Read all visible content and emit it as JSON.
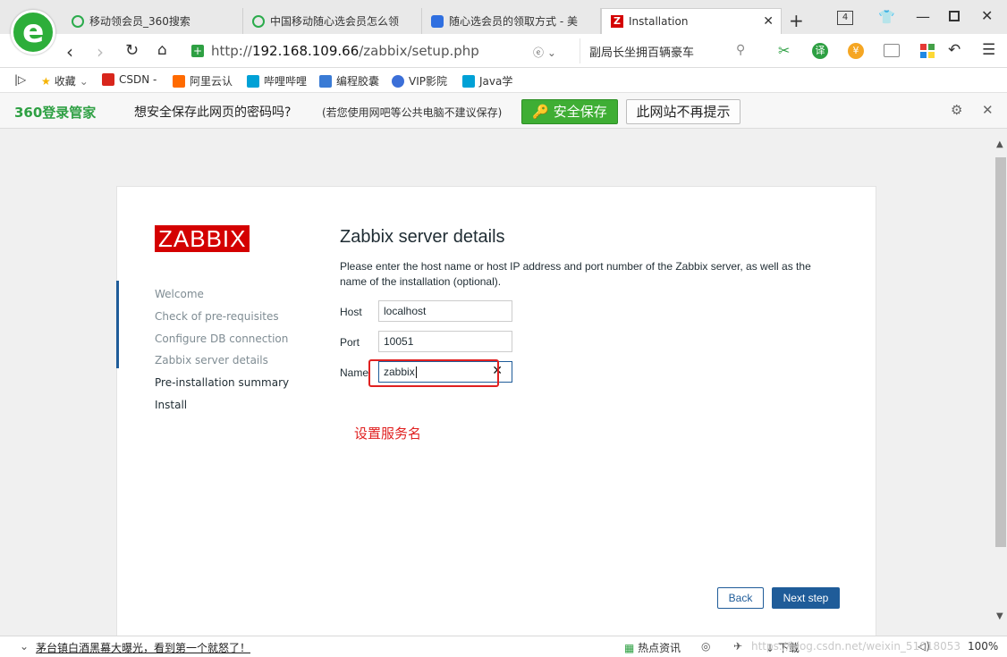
{
  "tabs": [
    {
      "title": "移动领会员_360搜索"
    },
    {
      "title": "中国移动随心选会员怎么领"
    },
    {
      "title": "随心选会员的领取方式 - 美"
    },
    {
      "title": "Installation"
    }
  ],
  "window": {
    "tab_count": "4"
  },
  "address": {
    "url_prefix": "http://",
    "url_host": "192.168.109.66",
    "url_path": "/zabbix/setup.php",
    "search_hint": "副局长坐拥百辆豪车"
  },
  "bookmarks": [
    "收藏",
    "CSDN -",
    "阿里云认",
    "哔哩哔哩",
    "编程胶囊",
    "VIP影院",
    "Java学"
  ],
  "password_bar": {
    "brand": "360登录管家",
    "question": "想安全保存此网页的密码吗?",
    "note": "(若您使用网吧等公共电脑不建议保存)",
    "save_label": "安全保存",
    "never_label": "此网站不再提示"
  },
  "page": {
    "logo": "ZABBIX",
    "steps": [
      {
        "label": "Welcome"
      },
      {
        "label": "Check of pre-requisites"
      },
      {
        "label": "Configure DB connection"
      },
      {
        "label": "Zabbix server details"
      },
      {
        "label": "Pre-installation summary"
      },
      {
        "label": "Install"
      }
    ],
    "title": "Zabbix server details",
    "description": "Please enter the host name or host IP address and port number of the Zabbix server, as well as the name of the installation (optional).",
    "fields": {
      "host_label": "Host",
      "host_value": "localhost",
      "port_label": "Port",
      "port_value": "10051",
      "name_label": "Name",
      "name_value": "zabbix"
    },
    "annotation": "设置服务名",
    "back_label": "Back",
    "next_label": "Next step"
  },
  "statusbar": {
    "news": "茅台镇白酒黑幕大曝光，看到第一个就怒了！",
    "hot": "热点资讯",
    "download": "下载",
    "watermark": "https://blog.csdn.net/weixin_51018053",
    "zoom": "100%"
  },
  "colors": {
    "zabbix_red": "#d40000",
    "zabbix_blue": "#1f5c99",
    "annotation_red": "#e02020",
    "save_green": "#3fae34"
  }
}
